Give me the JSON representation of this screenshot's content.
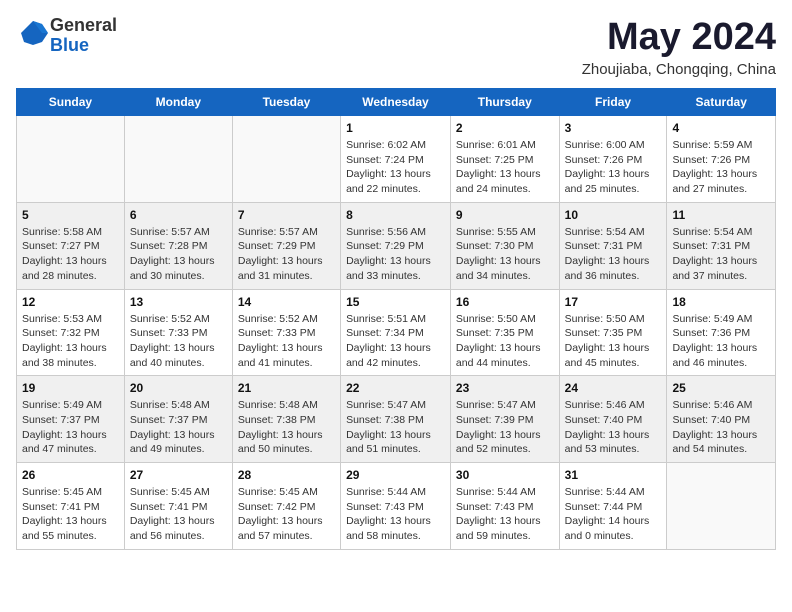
{
  "header": {
    "logo_line1": "General",
    "logo_line2": "Blue",
    "month": "May 2024",
    "location": "Zhoujiaba, Chongqing, China"
  },
  "weekdays": [
    "Sunday",
    "Monday",
    "Tuesday",
    "Wednesday",
    "Thursday",
    "Friday",
    "Saturday"
  ],
  "weeks": [
    [
      {
        "day": "",
        "sunrise": "",
        "sunset": "",
        "daylight": ""
      },
      {
        "day": "",
        "sunrise": "",
        "sunset": "",
        "daylight": ""
      },
      {
        "day": "",
        "sunrise": "",
        "sunset": "",
        "daylight": ""
      },
      {
        "day": "1",
        "sunrise": "Sunrise: 6:02 AM",
        "sunset": "Sunset: 7:24 PM",
        "daylight": "Daylight: 13 hours and 22 minutes."
      },
      {
        "day": "2",
        "sunrise": "Sunrise: 6:01 AM",
        "sunset": "Sunset: 7:25 PM",
        "daylight": "Daylight: 13 hours and 24 minutes."
      },
      {
        "day": "3",
        "sunrise": "Sunrise: 6:00 AM",
        "sunset": "Sunset: 7:26 PM",
        "daylight": "Daylight: 13 hours and 25 minutes."
      },
      {
        "day": "4",
        "sunrise": "Sunrise: 5:59 AM",
        "sunset": "Sunset: 7:26 PM",
        "daylight": "Daylight: 13 hours and 27 minutes."
      }
    ],
    [
      {
        "day": "5",
        "sunrise": "Sunrise: 5:58 AM",
        "sunset": "Sunset: 7:27 PM",
        "daylight": "Daylight: 13 hours and 28 minutes."
      },
      {
        "day": "6",
        "sunrise": "Sunrise: 5:57 AM",
        "sunset": "Sunset: 7:28 PM",
        "daylight": "Daylight: 13 hours and 30 minutes."
      },
      {
        "day": "7",
        "sunrise": "Sunrise: 5:57 AM",
        "sunset": "Sunset: 7:29 PM",
        "daylight": "Daylight: 13 hours and 31 minutes."
      },
      {
        "day": "8",
        "sunrise": "Sunrise: 5:56 AM",
        "sunset": "Sunset: 7:29 PM",
        "daylight": "Daylight: 13 hours and 33 minutes."
      },
      {
        "day": "9",
        "sunrise": "Sunrise: 5:55 AM",
        "sunset": "Sunset: 7:30 PM",
        "daylight": "Daylight: 13 hours and 34 minutes."
      },
      {
        "day": "10",
        "sunrise": "Sunrise: 5:54 AM",
        "sunset": "Sunset: 7:31 PM",
        "daylight": "Daylight: 13 hours and 36 minutes."
      },
      {
        "day": "11",
        "sunrise": "Sunrise: 5:54 AM",
        "sunset": "Sunset: 7:31 PM",
        "daylight": "Daylight: 13 hours and 37 minutes."
      }
    ],
    [
      {
        "day": "12",
        "sunrise": "Sunrise: 5:53 AM",
        "sunset": "Sunset: 7:32 PM",
        "daylight": "Daylight: 13 hours and 38 minutes."
      },
      {
        "day": "13",
        "sunrise": "Sunrise: 5:52 AM",
        "sunset": "Sunset: 7:33 PM",
        "daylight": "Daylight: 13 hours and 40 minutes."
      },
      {
        "day": "14",
        "sunrise": "Sunrise: 5:52 AM",
        "sunset": "Sunset: 7:33 PM",
        "daylight": "Daylight: 13 hours and 41 minutes."
      },
      {
        "day": "15",
        "sunrise": "Sunrise: 5:51 AM",
        "sunset": "Sunset: 7:34 PM",
        "daylight": "Daylight: 13 hours and 42 minutes."
      },
      {
        "day": "16",
        "sunrise": "Sunrise: 5:50 AM",
        "sunset": "Sunset: 7:35 PM",
        "daylight": "Daylight: 13 hours and 44 minutes."
      },
      {
        "day": "17",
        "sunrise": "Sunrise: 5:50 AM",
        "sunset": "Sunset: 7:35 PM",
        "daylight": "Daylight: 13 hours and 45 minutes."
      },
      {
        "day": "18",
        "sunrise": "Sunrise: 5:49 AM",
        "sunset": "Sunset: 7:36 PM",
        "daylight": "Daylight: 13 hours and 46 minutes."
      }
    ],
    [
      {
        "day": "19",
        "sunrise": "Sunrise: 5:49 AM",
        "sunset": "Sunset: 7:37 PM",
        "daylight": "Daylight: 13 hours and 47 minutes."
      },
      {
        "day": "20",
        "sunrise": "Sunrise: 5:48 AM",
        "sunset": "Sunset: 7:37 PM",
        "daylight": "Daylight: 13 hours and 49 minutes."
      },
      {
        "day": "21",
        "sunrise": "Sunrise: 5:48 AM",
        "sunset": "Sunset: 7:38 PM",
        "daylight": "Daylight: 13 hours and 50 minutes."
      },
      {
        "day": "22",
        "sunrise": "Sunrise: 5:47 AM",
        "sunset": "Sunset: 7:38 PM",
        "daylight": "Daylight: 13 hours and 51 minutes."
      },
      {
        "day": "23",
        "sunrise": "Sunrise: 5:47 AM",
        "sunset": "Sunset: 7:39 PM",
        "daylight": "Daylight: 13 hours and 52 minutes."
      },
      {
        "day": "24",
        "sunrise": "Sunrise: 5:46 AM",
        "sunset": "Sunset: 7:40 PM",
        "daylight": "Daylight: 13 hours and 53 minutes."
      },
      {
        "day": "25",
        "sunrise": "Sunrise: 5:46 AM",
        "sunset": "Sunset: 7:40 PM",
        "daylight": "Daylight: 13 hours and 54 minutes."
      }
    ],
    [
      {
        "day": "26",
        "sunrise": "Sunrise: 5:45 AM",
        "sunset": "Sunset: 7:41 PM",
        "daylight": "Daylight: 13 hours and 55 minutes."
      },
      {
        "day": "27",
        "sunrise": "Sunrise: 5:45 AM",
        "sunset": "Sunset: 7:41 PM",
        "daylight": "Daylight: 13 hours and 56 minutes."
      },
      {
        "day": "28",
        "sunrise": "Sunrise: 5:45 AM",
        "sunset": "Sunset: 7:42 PM",
        "daylight": "Daylight: 13 hours and 57 minutes."
      },
      {
        "day": "29",
        "sunrise": "Sunrise: 5:44 AM",
        "sunset": "Sunset: 7:43 PM",
        "daylight": "Daylight: 13 hours and 58 minutes."
      },
      {
        "day": "30",
        "sunrise": "Sunrise: 5:44 AM",
        "sunset": "Sunset: 7:43 PM",
        "daylight": "Daylight: 13 hours and 59 minutes."
      },
      {
        "day": "31",
        "sunrise": "Sunrise: 5:44 AM",
        "sunset": "Sunset: 7:44 PM",
        "daylight": "Daylight: 14 hours and 0 minutes."
      },
      {
        "day": "",
        "sunrise": "",
        "sunset": "",
        "daylight": ""
      }
    ]
  ]
}
